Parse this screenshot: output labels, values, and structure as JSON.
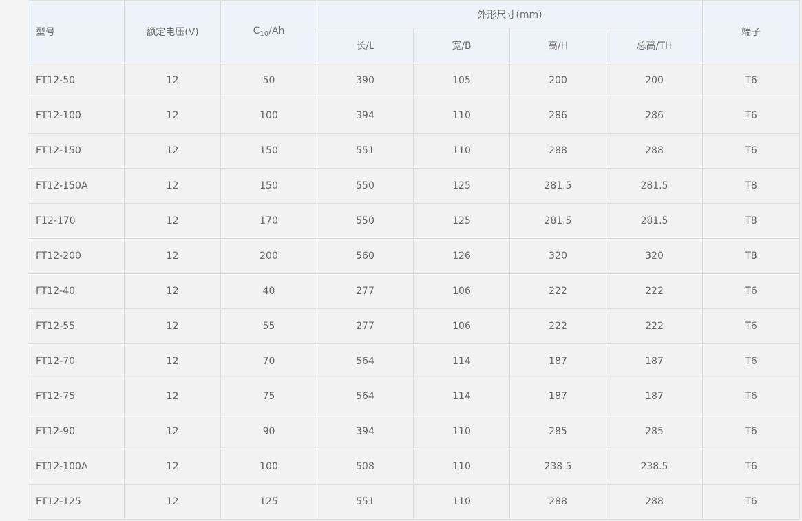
{
  "table": {
    "headers": {
      "model": "型号",
      "voltage": "额定电压(V)",
      "capacity_prefix": "C",
      "capacity_sub": "10",
      "capacity_suffix": "/Ah",
      "dimensions": "外形尺寸(mm)",
      "length": "长/L",
      "width": "宽/B",
      "height": "高/H",
      "total_height": "总高/TH",
      "terminal": "端子"
    },
    "rows": [
      {
        "model": "FT12-50",
        "voltage": "12",
        "capacity": "50",
        "length": "390",
        "width": "105",
        "height": "200",
        "total_height": "200",
        "terminal": "T6"
      },
      {
        "model": "FT12-100",
        "voltage": "12",
        "capacity": "100",
        "length": "394",
        "width": "110",
        "height": "286",
        "total_height": "286",
        "terminal": "T6"
      },
      {
        "model": "FT12-150",
        "voltage": "12",
        "capacity": "150",
        "length": "551",
        "width": "110",
        "height": "288",
        "total_height": "288",
        "terminal": "T6"
      },
      {
        "model": "FT12-150A",
        "voltage": "12",
        "capacity": "150",
        "length": "550",
        "width": "125",
        "height": "281.5",
        "total_height": "281.5",
        "terminal": "T8"
      },
      {
        "model": "F12-170",
        "voltage": "12",
        "capacity": "170",
        "length": "550",
        "width": "125",
        "height": "281.5",
        "total_height": "281.5",
        "terminal": "T8"
      },
      {
        "model": "FT12-200",
        "voltage": "12",
        "capacity": "200",
        "length": "560",
        "width": "126",
        "height": "320",
        "total_height": "320",
        "terminal": "T8"
      },
      {
        "model": "FT12-40",
        "voltage": "12",
        "capacity": "40",
        "length": "277",
        "width": "106",
        "height": "222",
        "total_height": "222",
        "terminal": "T6"
      },
      {
        "model": "FT12-55",
        "voltage": "12",
        "capacity": "55",
        "length": "277",
        "width": "106",
        "height": "222",
        "total_height": "222",
        "terminal": "T6"
      },
      {
        "model": "FT12-70",
        "voltage": "12",
        "capacity": "70",
        "length": "564",
        "width": "114",
        "height": "187",
        "total_height": "187",
        "terminal": "T6"
      },
      {
        "model": "FT12-75",
        "voltage": "12",
        "capacity": "75",
        "length": "564",
        "width": "114",
        "height": "187",
        "total_height": "187",
        "terminal": "T6"
      },
      {
        "model": "FT12-90",
        "voltage": "12",
        "capacity": "90",
        "length": "394",
        "width": "110",
        "height": "285",
        "total_height": "285",
        "terminal": "T6"
      },
      {
        "model": "FT12-100A",
        "voltage": "12",
        "capacity": "100",
        "length": "508",
        "width": "110",
        "height": "238.5",
        "total_height": "238.5",
        "terminal": "T6"
      },
      {
        "model": "FT12-125",
        "voltage": "12",
        "capacity": "125",
        "length": "551",
        "width": "110",
        "height": "288",
        "total_height": "288",
        "terminal": "T6"
      }
    ]
  },
  "colors": {
    "header_bg": "#eef3f9",
    "body_bg": "#f2f2f2",
    "border": "#dcdcdc",
    "text": "#666666"
  }
}
